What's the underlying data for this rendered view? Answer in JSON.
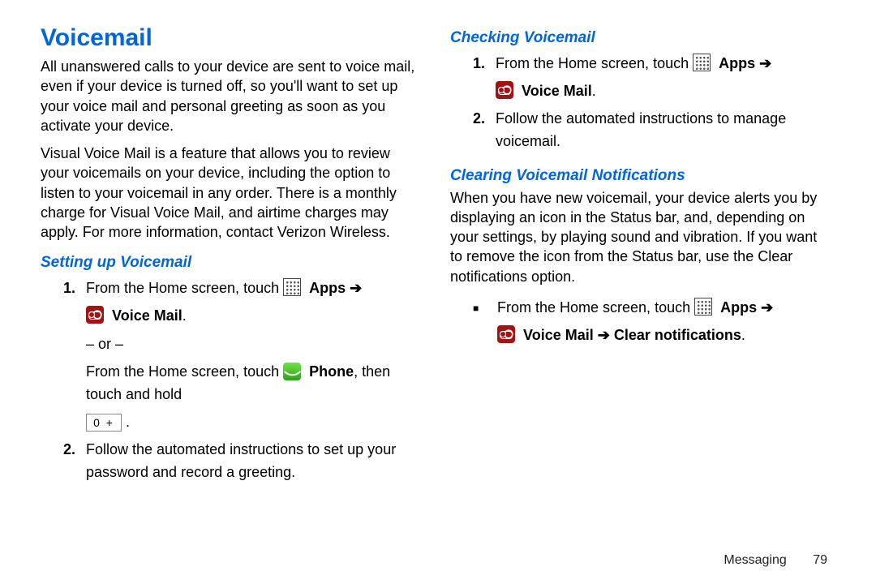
{
  "title": "Voicemail",
  "intro_p1": "All unanswered calls to your device are sent to voice mail, even if your device is turned off, so you'll want to set up your voice mail and personal greeting as soon as you activate your device.",
  "intro_p2": "Visual Voice Mail is a feature that allows you to review your voicemails on your device, including the option to listen to your voicemail in any order. There is a monthly charge for Visual Voice Mail, and airtime charges may apply. For more information, contact Verizon Wireless.",
  "setup_heading": "Setting up Voicemail",
  "setup_step1_a": "From the Home screen, touch ",
  "apps_label": "Apps",
  "arrow": "➔",
  "voicemail_label": "Voice Mail",
  "or_text": "– or –",
  "setup_step1_b": "From the Home screen, touch ",
  "phone_label": "Phone",
  "setup_step1_b_tail": ", then touch and hold ",
  "zero_key": "0 +",
  "setup_step2": "Follow the automated instructions to set up your password and record a greeting.",
  "checking_heading": "Checking Voicemail",
  "checking_step1": "From the Home screen, touch ",
  "checking_step2": "Follow the automated instructions to manage voicemail.",
  "clearing_heading": "Clearing Voicemail Notifications",
  "clearing_para": "When you have new voicemail, your device alerts you by displaying an icon in the Status bar, and, depending on your settings, by playing sound and vibration. If you want to remove the icon from the Status bar, use the Clear notifications option.",
  "clearing_bullet_a": "From the Home screen, touch ",
  "clear_notif_tail": "Clear notifications",
  "footer_section": "Messaging",
  "footer_page": "79",
  "period": ".",
  "num1": "1.",
  "num2": "2."
}
